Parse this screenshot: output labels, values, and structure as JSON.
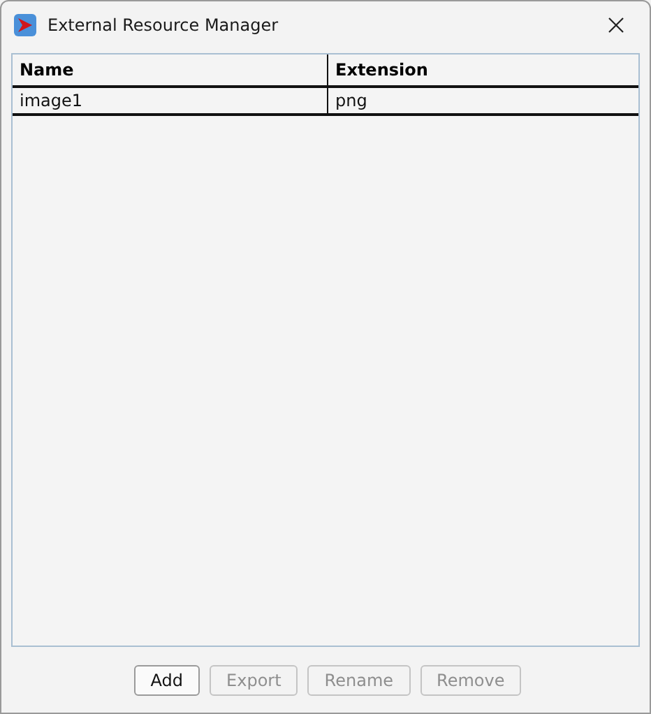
{
  "window": {
    "title": "External Resource Manager"
  },
  "table": {
    "columns": [
      "Name",
      "Extension"
    ],
    "rows": [
      {
        "cells": [
          "image1",
          "png"
        ],
        "selected": false
      }
    ]
  },
  "buttons": [
    {
      "label": "Add",
      "disabled": false
    },
    {
      "label": "Export",
      "disabled": true
    },
    {
      "label": "Rename",
      "disabled": true
    },
    {
      "label": "Remove",
      "disabled": true
    }
  ]
}
